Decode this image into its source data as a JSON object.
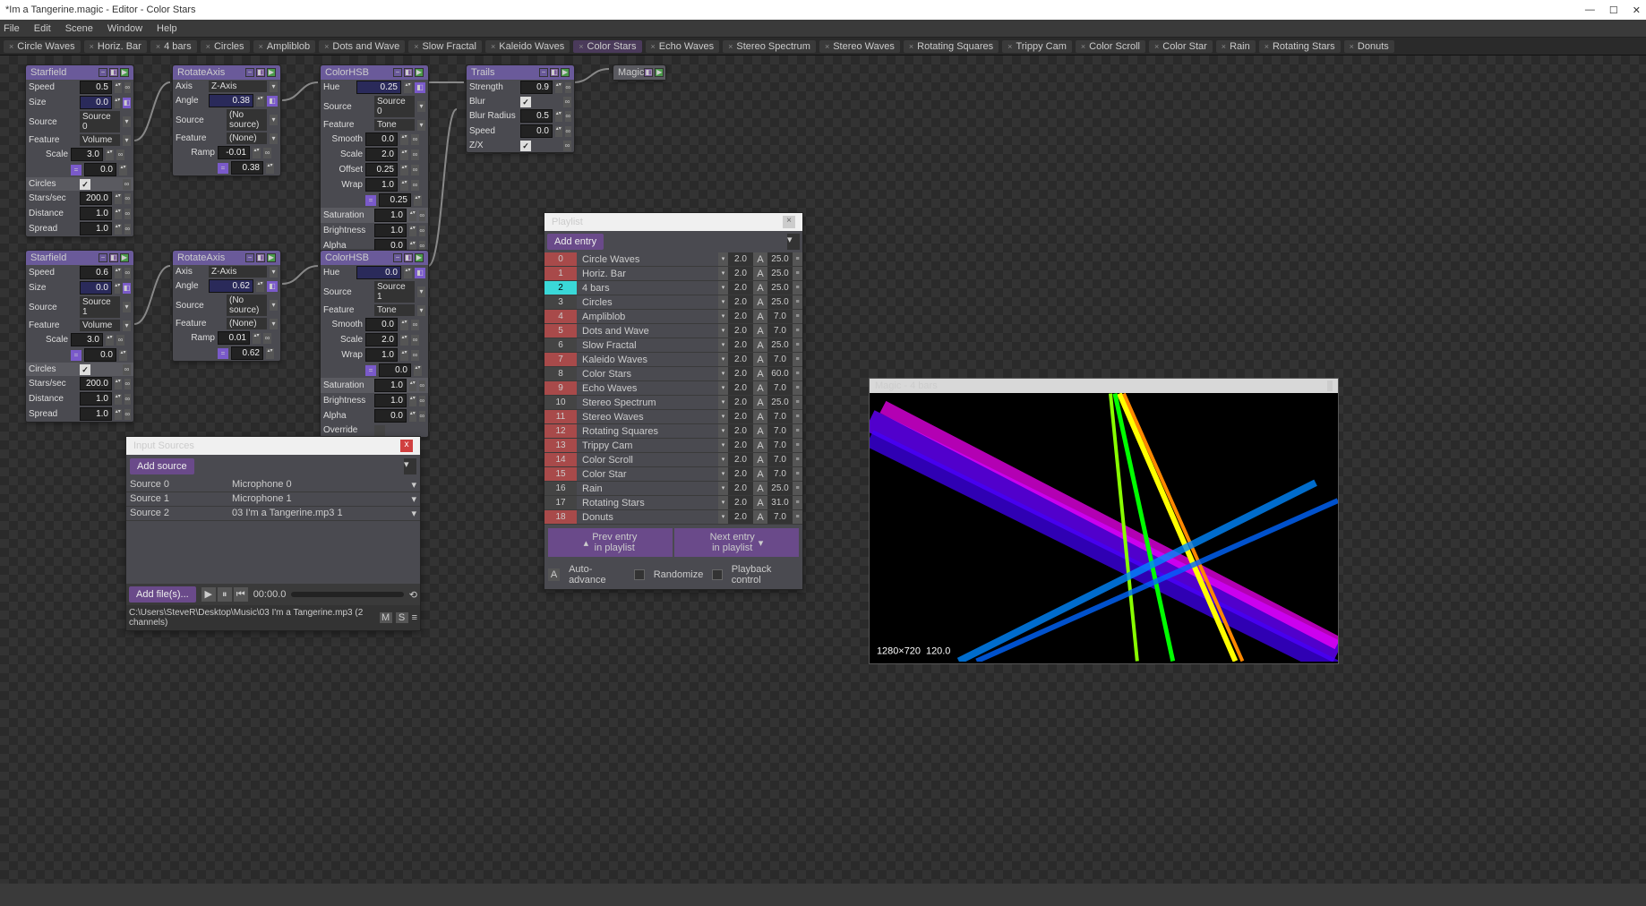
{
  "window_title": "*Im a Tangerine.magic - Editor - Color Stars",
  "menu": [
    "File",
    "Edit",
    "Scene",
    "Window",
    "Help"
  ],
  "tabs": [
    "Circle Waves",
    "Horiz. Bar",
    "4 bars",
    "Circles",
    "Ampliblob",
    "Dots and Wave",
    "Slow Fractal",
    "Kaleido Waves",
    "Color Stars",
    "Echo Waves",
    "Stereo Spectrum",
    "Stereo Waves",
    "Rotating Squares",
    "Trippy Cam",
    "Color Scroll",
    "Color Star",
    "Rain",
    "Rotating Stars",
    "Donuts"
  ],
  "active_tab": "Color Stars",
  "nodes": {
    "starfield1": {
      "title": "Starfield",
      "speed": "0.5",
      "size": "0.0",
      "source": "Source 0",
      "feature": "Volume",
      "scale": "3.0",
      "scale2": "0.0",
      "circles": true,
      "stars_sec": "200.0",
      "distance": "1.0",
      "spread": "1.0"
    },
    "starfield2": {
      "title": "Starfield",
      "speed": "0.6",
      "size": "0.0",
      "source": "Source 1",
      "feature": "Volume",
      "scale": "3.0",
      "scale2": "0.0",
      "circles": true,
      "stars_sec": "200.0",
      "distance": "1.0",
      "spread": "1.0"
    },
    "rotate1": {
      "title": "RotateAxis",
      "axis": "Z-Axis",
      "angle": "0.38",
      "source": "(No source)",
      "feature": "(None)",
      "ramp": "-0.01",
      "val": "0.38"
    },
    "rotate2": {
      "title": "RotateAxis",
      "axis": "Z-Axis",
      "angle": "0.62",
      "source": "(No source)",
      "feature": "(None)",
      "ramp": "0.01",
      "val": "0.62"
    },
    "color1": {
      "title": "ColorHSB",
      "hue": "0.25",
      "source": "Source 0",
      "feature": "Tone",
      "smooth": "0.0",
      "scale": "2.0",
      "offset": "0.25",
      "wrap": "1.0",
      "val": "0.25",
      "saturation": "1.0",
      "brightness": "1.0",
      "alpha": "0.0",
      "override": ""
    },
    "color2": {
      "title": "ColorHSB",
      "hue": "0.0",
      "source": "Source 1",
      "feature": "Tone",
      "smooth": "0.0",
      "scale": "2.0",
      "wrap": "1.0",
      "val": "0.0",
      "saturation": "1.0",
      "brightness": "1.0",
      "alpha": "0.0",
      "override": ""
    },
    "trails": {
      "title": "Trails",
      "strength": "0.9",
      "blur": true,
      "blur_radius": "0.5",
      "speed": "0.0",
      "zx": true
    },
    "magic": {
      "title": "Magic"
    }
  },
  "input_sources": {
    "title": "Input Sources",
    "add": "Add source",
    "rows": [
      {
        "name": "Source 0",
        "dev": "Microphone 0"
      },
      {
        "name": "Source 1",
        "dev": "Microphone 1"
      },
      {
        "name": "Source 2",
        "dev": "03 I'm a Tangerine.mp3 1"
      }
    ],
    "add_files": "Add file(s)...",
    "time": "00:00.0",
    "path": "C:\\Users\\SteveR\\Desktop\\Music\\03 I'm a Tangerine.mp3 (2 channels)"
  },
  "playlist": {
    "title": "Playlist",
    "add": "Add entry",
    "items": [
      {
        "n": "0",
        "c": "red",
        "name": "Circle Waves",
        "v1": "2.0",
        "v2": "25.0"
      },
      {
        "n": "1",
        "c": "red",
        "name": "Horiz. Bar",
        "v1": "2.0",
        "v2": "25.0"
      },
      {
        "n": "2",
        "c": "cyan",
        "name": "4 bars",
        "v1": "2.0",
        "v2": "25.0"
      },
      {
        "n": "3",
        "c": "plain",
        "name": "Circles",
        "v1": "2.0",
        "v2": "25.0"
      },
      {
        "n": "4",
        "c": "red",
        "name": "Ampliblob",
        "v1": "2.0",
        "v2": "7.0"
      },
      {
        "n": "5",
        "c": "red",
        "name": "Dots and Wave",
        "v1": "2.0",
        "v2": "7.0"
      },
      {
        "n": "6",
        "c": "plain",
        "name": "Slow Fractal",
        "v1": "2.0",
        "v2": "25.0"
      },
      {
        "n": "7",
        "c": "red",
        "name": "Kaleido Waves",
        "v1": "2.0",
        "v2": "7.0"
      },
      {
        "n": "8",
        "c": "plain",
        "name": "Color Stars",
        "v1": "2.0",
        "v2": "60.0"
      },
      {
        "n": "9",
        "c": "red",
        "name": "Echo Waves",
        "v1": "2.0",
        "v2": "7.0"
      },
      {
        "n": "10",
        "c": "plain",
        "name": "Stereo Spectrum",
        "v1": "2.0",
        "v2": "25.0"
      },
      {
        "n": "11",
        "c": "red",
        "name": "Stereo Waves",
        "v1": "2.0",
        "v2": "7.0"
      },
      {
        "n": "12",
        "c": "red",
        "name": "Rotating Squares",
        "v1": "2.0",
        "v2": "7.0"
      },
      {
        "n": "13",
        "c": "red",
        "name": "Trippy Cam",
        "v1": "2.0",
        "v2": "7.0"
      },
      {
        "n": "14",
        "c": "red",
        "name": "Color Scroll",
        "v1": "2.0",
        "v2": "7.0"
      },
      {
        "n": "15",
        "c": "red",
        "name": "Color Star",
        "v1": "2.0",
        "v2": "7.0"
      },
      {
        "n": "16",
        "c": "plain",
        "name": "Rain",
        "v1": "2.0",
        "v2": "25.0"
      },
      {
        "n": "17",
        "c": "plain",
        "name": "Rotating Stars",
        "v1": "2.0",
        "v2": "31.0"
      },
      {
        "n": "18",
        "c": "red",
        "name": "Donuts",
        "v1": "2.0",
        "v2": "7.0"
      }
    ],
    "prev": "Prev entry\nin playlist",
    "next": "Next entry\nin playlist",
    "auto": "Auto-advance",
    "rand": "Randomize",
    "pb": "Playback control"
  },
  "preview": {
    "title": "Magic - 4 bars",
    "res": "1280×720",
    "fps": "120.0"
  },
  "labels": {
    "speed": "Speed",
    "size": "Size",
    "source": "Source",
    "feature": "Feature",
    "scale": "Scale",
    "circles": "Circles",
    "stars_sec": "Stars/sec",
    "distance": "Distance",
    "spread": "Spread",
    "axis": "Axis",
    "angle": "Angle",
    "ramp": "Ramp",
    "hue": "Hue",
    "smooth": "Smooth",
    "offset": "Offset",
    "wrap": "Wrap",
    "saturation": "Saturation",
    "brightness": "Brightness",
    "alpha": "Alpha",
    "override": "Override",
    "strength": "Strength",
    "blur": "Blur",
    "blur_radius": "Blur Radius",
    "zx": "Z/X",
    "M": "M",
    "S": "S",
    "A": "A"
  }
}
